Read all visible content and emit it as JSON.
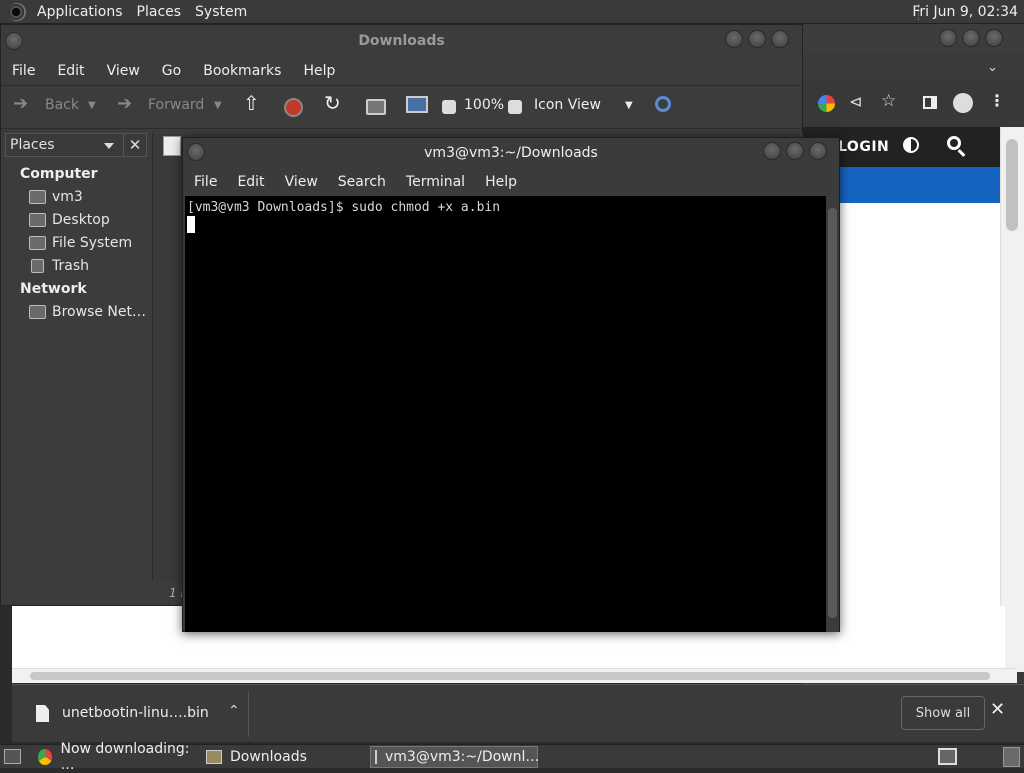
{
  "top_panel": {
    "menus": [
      "Applications",
      "Places",
      "System"
    ],
    "clock": "Fri Jun  9, 02:34"
  },
  "file_manager": {
    "title": "Downloads",
    "menus": [
      "File",
      "Edit",
      "View",
      "Go",
      "Bookmarks",
      "Help"
    ],
    "toolbar": {
      "back": "Back",
      "forward": "Forward",
      "zoom": "100%",
      "view_mode": "Icon View"
    },
    "sidebar": {
      "header": "Places",
      "computer_label": "Computer",
      "computer_items": [
        "vm3",
        "Desktop",
        "File System",
        "Trash"
      ],
      "network_label": "Network",
      "network_items": [
        "Browse Net…"
      ]
    },
    "status": "1 i"
  },
  "terminal": {
    "title": "vm3@vm3:~/Downloads",
    "menus": [
      "File",
      "Edit",
      "View",
      "Search",
      "Terminal",
      "Help"
    ],
    "lines": [
      "[vm3@vm3 Downloads]$ sudo chmod +x a.bin"
    ]
  },
  "browser": {
    "login": "LOGIN",
    "download_item": "unetbootin-linu….bin",
    "show_all": "Show all"
  },
  "taskbar": {
    "tasks": [
      "Now downloading: …",
      "Downloads",
      "vm3@vm3:~/Downl…"
    ]
  },
  "colors": {
    "accent_blue": "#1565c0",
    "terminal_bg": "#000000",
    "panel_bg": "#3a3a3a"
  }
}
